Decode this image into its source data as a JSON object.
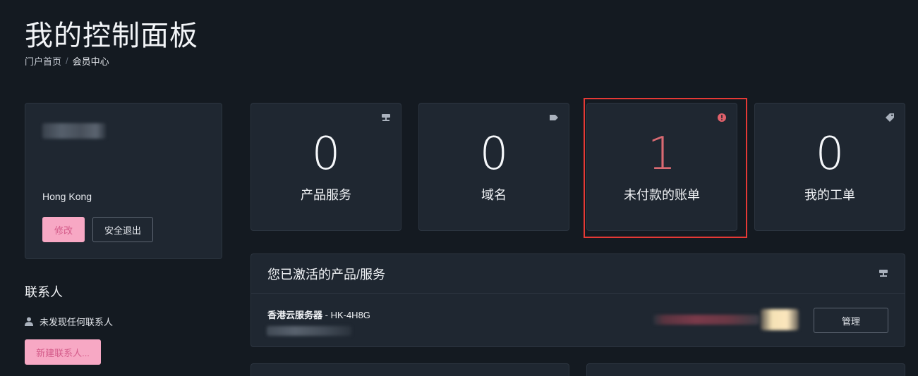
{
  "header": {
    "title": "我的控制面板",
    "breadcrumb": [
      {
        "label": "门户首页"
      },
      {
        "label": "会员中心"
      }
    ],
    "separator": "/"
  },
  "profile": {
    "region": "Hong Kong",
    "edit_label": "修改",
    "logout_label": "安全退出"
  },
  "contacts": {
    "title": "联系人",
    "empty_text": "未发现任何联系人",
    "new_contact_label": "新建联系人..."
  },
  "stats": [
    {
      "value": "0",
      "label": "产品服务",
      "icon": "server-icon"
    },
    {
      "value": "0",
      "label": "域名",
      "icon": "tag-icon"
    },
    {
      "value": "1",
      "label": "未付款的账单",
      "icon": "alert-circle-icon"
    },
    {
      "value": "0",
      "label": "我的工单",
      "icon": "ticket-tag-icon"
    }
  ],
  "products": {
    "title": "您已激活的产品/服务",
    "items": [
      {
        "name_bold": "香港云服务器",
        "name_suffix": " - HK-4H8G",
        "action_label": "管理"
      }
    ]
  },
  "colors": {
    "background": "#141a21",
    "card": "#1f2731",
    "accent_pink": "#f7a8c4",
    "unpaid_red": "#d96a72",
    "highlight_border": "#e53935"
  }
}
